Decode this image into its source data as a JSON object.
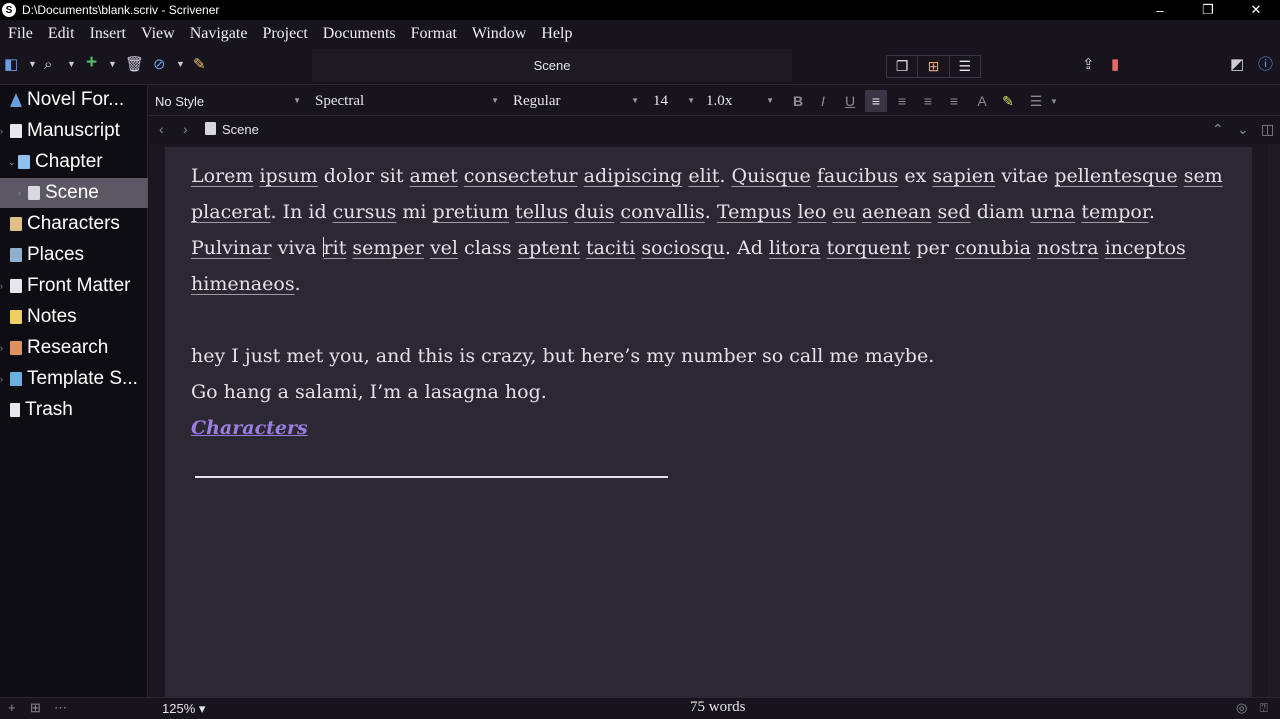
{
  "window": {
    "title": "D:\\Documents\\blank.scriv - Scrivener",
    "app_icon": "S",
    "minimize": "–",
    "restore": "❐",
    "close": "✕"
  },
  "menu": [
    "File",
    "Edit",
    "Insert",
    "View",
    "Navigate",
    "Project",
    "Documents",
    "Format",
    "Window",
    "Help"
  ],
  "toolbar": {
    "center_title": "Scene",
    "icons": [
      "binder-toggle-icon",
      "search-icon",
      "add-icon",
      "trash-icon",
      "attachment-icon",
      "compose-icon",
      "scrivenings-icon",
      "corkboard-icon",
      "outliner-icon",
      "share-icon",
      "bookmark-icon",
      "inspector-toggle-icon",
      "info-icon"
    ],
    "bookmark_color": "#e86a6a",
    "add_color": "#4fc06a",
    "attach_color": "#6a9ee8",
    "corkboard_color": "#f0a060"
  },
  "binder": {
    "items": [
      {
        "label": "Novel For...",
        "color": "#6aa0e0",
        "expander": ""
      },
      {
        "label": "Manuscript",
        "color": "#e8e6ea",
        "expander": "›"
      },
      {
        "label": "Chapter",
        "color": "#8fc0f0",
        "expander": "⌄"
      },
      {
        "label": "Scene",
        "color": "#d8d6de",
        "expander": "›"
      },
      {
        "label": "Characters",
        "color": "#e0c080",
        "expander": ""
      },
      {
        "label": "Places",
        "color": "#90b0d0",
        "expander": ""
      },
      {
        "label": "Front Matter",
        "color": "#e8e6ea",
        "expander": "›"
      },
      {
        "label": "Notes",
        "color": "#f0d060",
        "expander": ""
      },
      {
        "label": "Research",
        "color": "#e09060",
        "expander": "›"
      },
      {
        "label": "Template S...",
        "color": "#6ab0e0",
        "expander": "›"
      },
      {
        "label": "Trash",
        "color": "#e8e6ea",
        "expander": ""
      }
    ],
    "selected_index": 3
  },
  "format": {
    "style": "No Style",
    "font": "Spectral",
    "weight": "Regular",
    "size": "14",
    "spacing": "1.0x",
    "buttons": [
      "B",
      "I",
      "U"
    ]
  },
  "header": {
    "title": "Scene"
  },
  "document": {
    "para1_words": [
      "Lorem",
      "ipsum",
      "dolor sit",
      "amet",
      "consectetur",
      "adipiscing",
      "elit",
      ". ",
      "Quisque",
      "faucibus",
      "ex",
      "sapien",
      "vitae",
      "pellentesque",
      "sem",
      "placerat",
      ". In id",
      "cursus",
      "mi",
      "pretium",
      "tellus",
      "duis",
      "convallis",
      ". ",
      "Tempus",
      "leo",
      "eu",
      "aenean",
      "sed",
      "diam",
      "urna",
      "tempor",
      ". ",
      "Pulvinar",
      "viva",
      "rit",
      "semper",
      "vel",
      "class",
      "aptent",
      "taciti",
      "sociosqu",
      ". Ad",
      "litora",
      "torquent",
      "per",
      "conubia",
      "nostra",
      "inceptos",
      "himenaeos",
      "."
    ],
    "line1": "hey I just met you, and this is crazy, but here’s my number so call me maybe.",
    "line2": "Go hang a salami, I’m a lasagna hog.",
    "link_text": "Characters"
  },
  "footer": {
    "zoom": "125%",
    "word_count": "75 words"
  }
}
